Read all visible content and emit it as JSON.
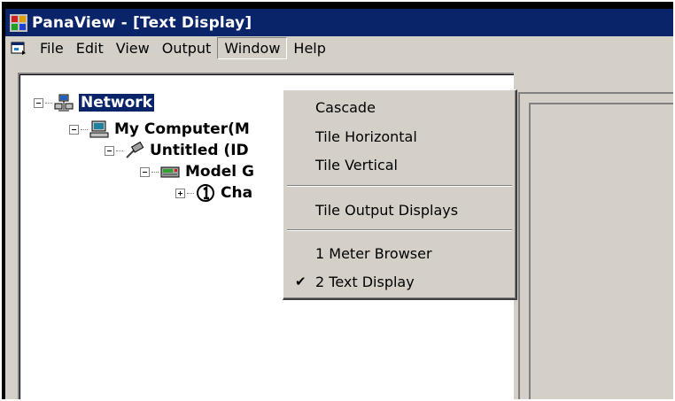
{
  "window": {
    "title": "PanaView - [Text Display]"
  },
  "menubar": {
    "items": [
      "File",
      "Edit",
      "View",
      "Output",
      "Window",
      "Help"
    ],
    "open_item": "Window"
  },
  "tree": {
    "nodes": [
      {
        "label": "Network",
        "selected": true
      },
      {
        "label": "My Computer(M"
      },
      {
        "label": "Untitled (ID"
      },
      {
        "label": "Model G"
      },
      {
        "label": "Cha"
      }
    ]
  },
  "window_menu": {
    "items": [
      {
        "label": "Cascade"
      },
      {
        "label": "Tile Horizontal"
      },
      {
        "label": "Tile Vertical"
      },
      {
        "label": "Tile Output Displays"
      },
      {
        "label": "1 Meter Browser"
      },
      {
        "label": "2 Text Display",
        "checked": true,
        "check_glyph": "✔"
      }
    ]
  }
}
